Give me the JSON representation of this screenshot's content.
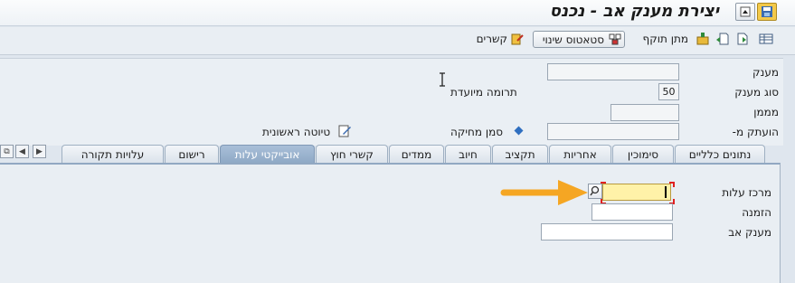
{
  "window": {
    "title": "יצירת מענק אב - נכנס"
  },
  "toolbar": {
    "validity_label": "מתן תוקף",
    "status_button_label": "סטאטוס שינוי",
    "links_label": "קשרים"
  },
  "header": {
    "grant_label": "מענק",
    "grant_value": "",
    "grant_type_label": "סוג מענק",
    "grant_type_value": "50",
    "grant_type_desc": "תרומה מיועדת",
    "sponsor_label": "מממן",
    "sponsor_value": "",
    "copied_from_label": "הועתק מ-",
    "copied_from_value": "",
    "deletion_flag_label": "סמן מחיקה",
    "draft_label": "טיוטה ראשונית"
  },
  "tabs": [
    {
      "label": "נתונים כלליים",
      "active": false
    },
    {
      "label": "סימוכין",
      "active": false
    },
    {
      "label": "אחריות",
      "active": false
    },
    {
      "label": "תקציב",
      "active": false
    },
    {
      "label": "חיוב",
      "active": false
    },
    {
      "label": "ממדים",
      "active": false
    },
    {
      "label": "קשרי חוץ",
      "active": false
    },
    {
      "label": "אובייקטי עלות",
      "active": true
    },
    {
      "label": "רישום",
      "active": false
    },
    {
      "label": "עלויות תקורה",
      "active": false
    }
  ],
  "tab_content": {
    "cost_center_label": "מרכז עלות",
    "cost_center_value": "",
    "order_label": "הזמנה",
    "order_value": "",
    "parent_grant_label": "מענק אב",
    "parent_grant_value": ""
  },
  "colors": {
    "active_tab": "#8fa9c6",
    "required_field": "#fff2a8",
    "arrow": "#f5a623"
  },
  "icons": [
    "save-icon",
    "menu-icon",
    "table-icon",
    "new-icon",
    "transfer-icon",
    "validity-icon",
    "status-icon",
    "links-icon",
    "diamond-icon",
    "pencil-icon",
    "search-help-icon"
  ]
}
